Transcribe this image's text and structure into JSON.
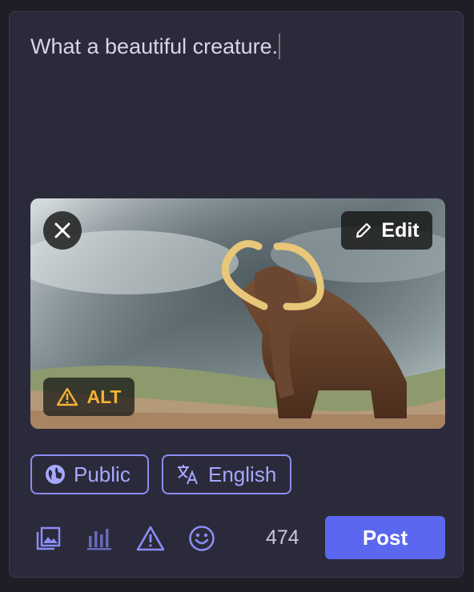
{
  "composer": {
    "text": "What a beautiful creature."
  },
  "media": {
    "edit_label": "Edit",
    "alt_label": "ALT",
    "alt_warning_color": "#f5b131",
    "remove_icon": "close-icon",
    "image_subject": "woolly mammoth"
  },
  "options": {
    "visibility_label": "Public",
    "language_label": "English"
  },
  "toolbar": {
    "icons": [
      "image-icon",
      "poll-icon",
      "content-warning-icon",
      "emoji-icon"
    ],
    "char_count": "474",
    "post_label": "Post",
    "accent_color": "#5c67f0"
  }
}
